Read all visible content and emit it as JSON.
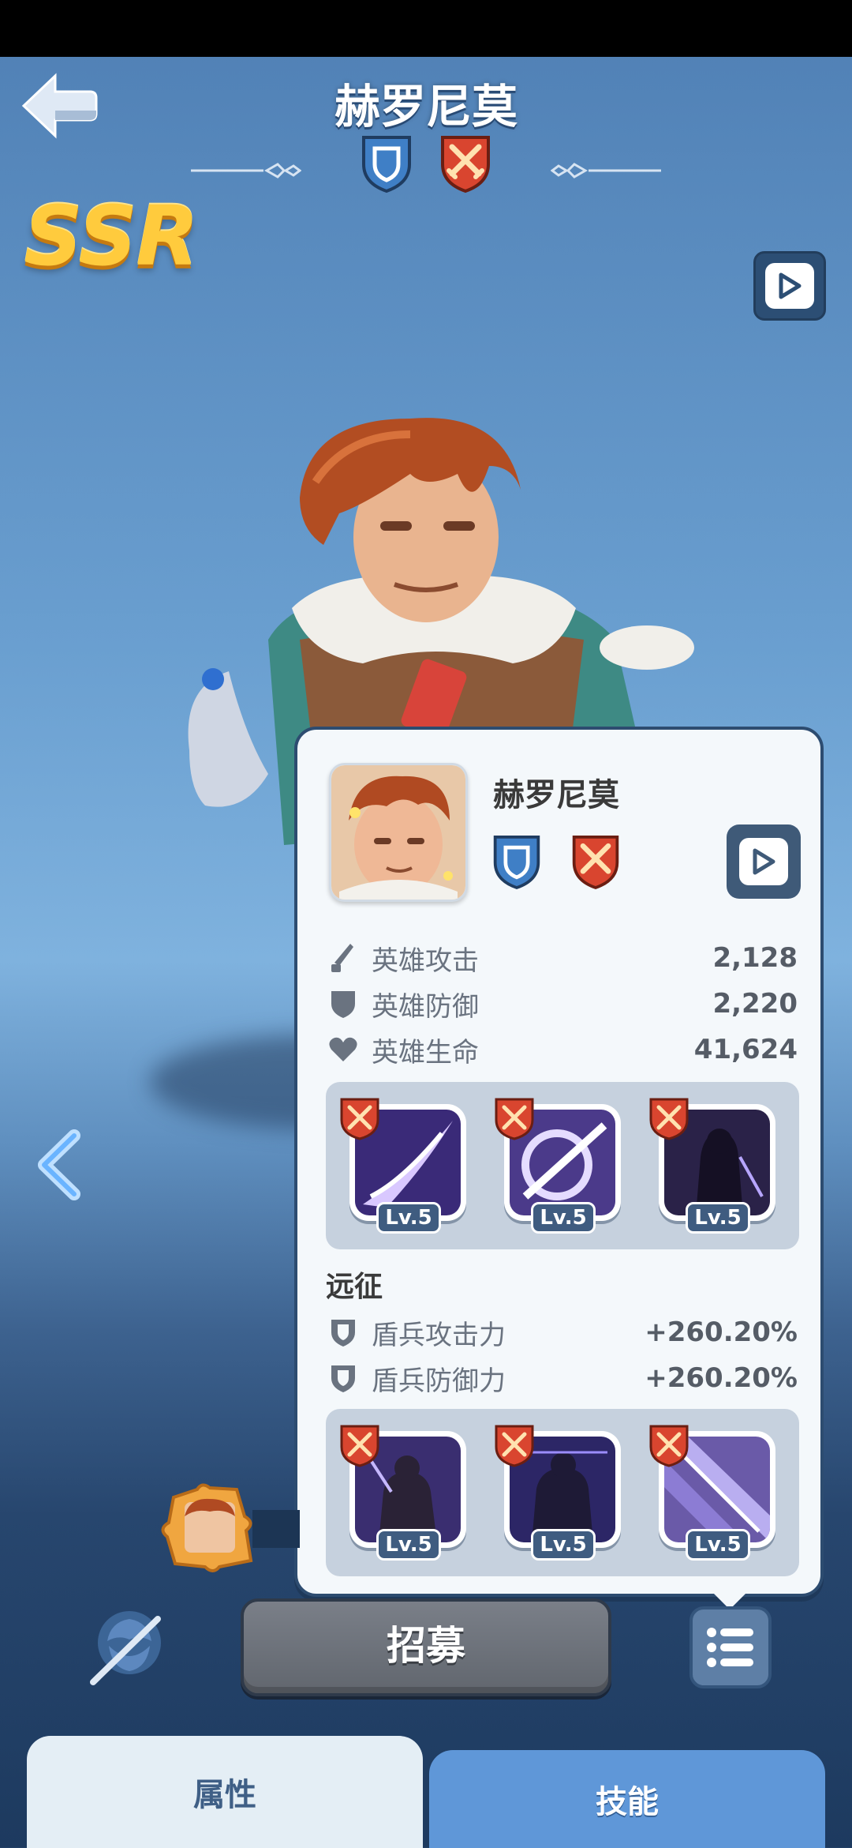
{
  "header": {
    "hero_name": "赫罗尼莫",
    "rarity": "SSR"
  },
  "card": {
    "hero_name": "赫罗尼莫",
    "stats": [
      {
        "icon": "sword-icon",
        "label": "英雄攻击",
        "value": "2,128"
      },
      {
        "icon": "shield-icon",
        "label": "英雄防御",
        "value": "2,220"
      },
      {
        "icon": "heart-icon",
        "label": "英雄生命",
        "value": "41,624"
      }
    ],
    "skills_top": [
      {
        "level": "Lv.5"
      },
      {
        "level": "Lv.5"
      },
      {
        "level": "Lv.5"
      }
    ],
    "expedition": {
      "title": "远征",
      "stats": [
        {
          "icon": "shield-icon",
          "label": "盾兵攻击力",
          "value": "+260.20%"
        },
        {
          "icon": "shield-icon",
          "label": "盾兵防御力",
          "value": "+260.20%"
        }
      ]
    },
    "skills_bottom": [
      {
        "level": "Lv.5"
      },
      {
        "level": "Lv.5"
      },
      {
        "level": "Lv.5"
      }
    ]
  },
  "actions": {
    "recruit_label": "招募"
  },
  "tabs": {
    "attributes": "属性",
    "skills": "技能"
  },
  "colors": {
    "ssr_gold": "#ffcb3d",
    "badge_blue": "#3f7fc6",
    "badge_red": "#d9452f",
    "panel_bg": "#f4f8fb",
    "tab_active": "#5f97d8"
  }
}
